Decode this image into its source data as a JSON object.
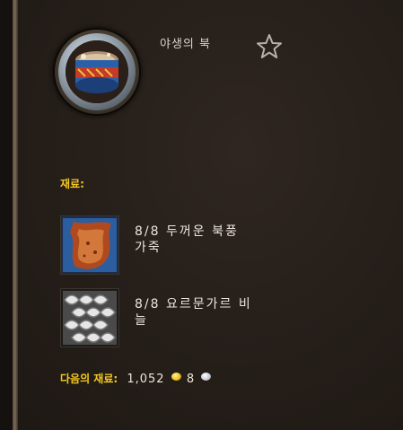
{
  "recipe": {
    "title": "야생의 북",
    "favorite_icon": "star-outline-icon"
  },
  "reagents": {
    "label": "재료:",
    "items": [
      {
        "icon": "heavy-storm-leather-icon",
        "count": "8/8",
        "name_line1": "두꺼운 북풍",
        "name_line2": "가죽"
      },
      {
        "icon": "scale-icon",
        "count": "8/8",
        "name_line1": "요르문가르 비",
        "name_line2": "늘"
      }
    ]
  },
  "cost": {
    "label": "다음의 재료:",
    "gold": "1,052",
    "silver": "8",
    "colors": {
      "label": "#f4c81f",
      "gold_coin": "#f0c21e",
      "silver_coin": "#c9cfd6"
    }
  }
}
